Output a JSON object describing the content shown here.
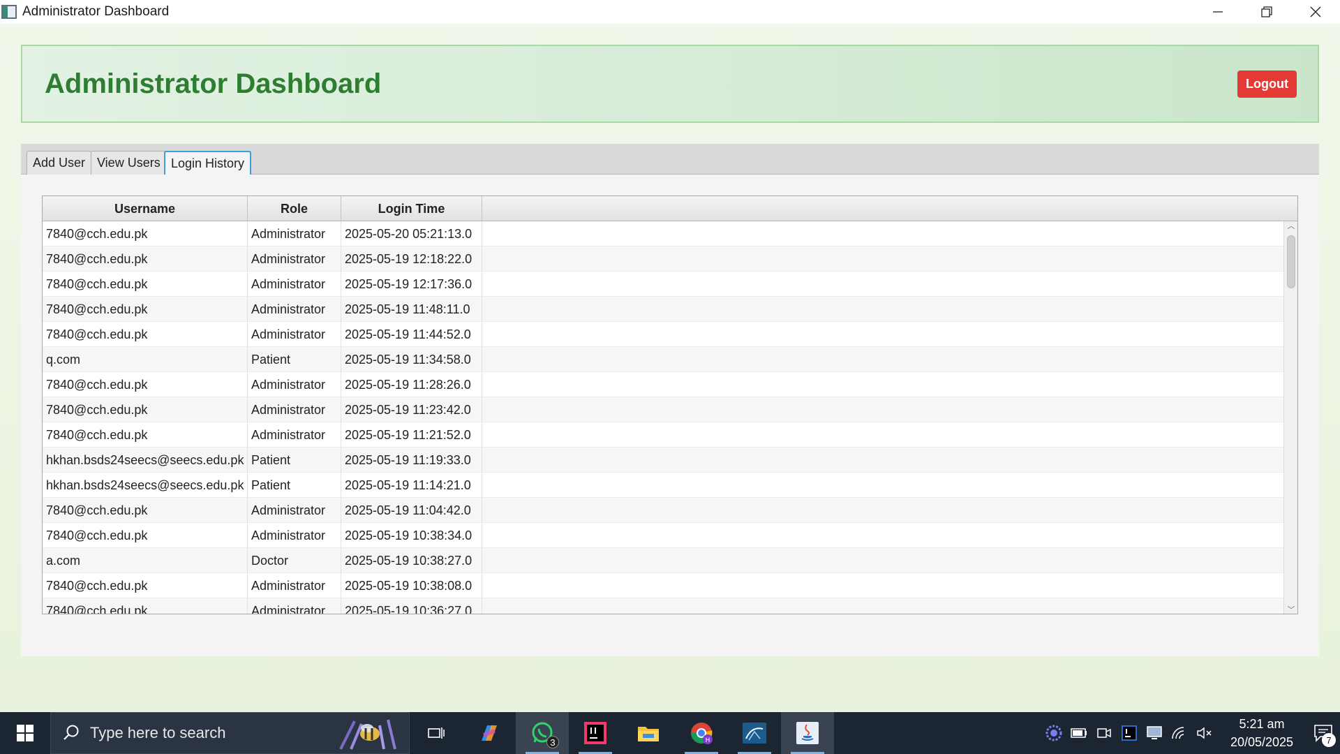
{
  "window": {
    "title": "Administrator Dashboard"
  },
  "header": {
    "title": "Administrator Dashboard",
    "logout_label": "Logout"
  },
  "tabs": [
    {
      "label": "Add User",
      "selected": false
    },
    {
      "label": "View Users",
      "selected": false
    },
    {
      "label": "Login History",
      "selected": true
    }
  ],
  "table": {
    "columns": [
      "Username",
      "Role",
      "Login Time"
    ],
    "rows": [
      {
        "username": "7840@cch.edu.pk",
        "role": "Administrator",
        "time": "2025-05-20 05:21:13.0"
      },
      {
        "username": "7840@cch.edu.pk",
        "role": "Administrator",
        "time": "2025-05-19 12:18:22.0"
      },
      {
        "username": "7840@cch.edu.pk",
        "role": "Administrator",
        "time": "2025-05-19 12:17:36.0"
      },
      {
        "username": "7840@cch.edu.pk",
        "role": "Administrator",
        "time": "2025-05-19 11:48:11.0"
      },
      {
        "username": "7840@cch.edu.pk",
        "role": "Administrator",
        "time": "2025-05-19 11:44:52.0"
      },
      {
        "username": "q.com",
        "role": "Patient",
        "time": "2025-05-19 11:34:58.0"
      },
      {
        "username": "7840@cch.edu.pk",
        "role": "Administrator",
        "time": "2025-05-19 11:28:26.0"
      },
      {
        "username": "7840@cch.edu.pk",
        "role": "Administrator",
        "time": "2025-05-19 11:23:42.0"
      },
      {
        "username": "7840@cch.edu.pk",
        "role": "Administrator",
        "time": "2025-05-19 11:21:52.0"
      },
      {
        "username": "hkhan.bsds24seecs@seecs.edu.pk",
        "role": "Patient",
        "time": "2025-05-19 11:19:33.0"
      },
      {
        "username": "hkhan.bsds24seecs@seecs.edu.pk",
        "role": "Patient",
        "time": "2025-05-19 11:14:21.0"
      },
      {
        "username": "7840@cch.edu.pk",
        "role": "Administrator",
        "time": "2025-05-19 11:04:42.0"
      },
      {
        "username": "7840@cch.edu.pk",
        "role": "Administrator",
        "time": "2025-05-19 10:38:34.0"
      },
      {
        "username": "a.com",
        "role": "Doctor",
        "time": "2025-05-19 10:38:27.0"
      },
      {
        "username": "7840@cch.edu.pk",
        "role": "Administrator",
        "time": "2025-05-19 10:38:08.0"
      },
      {
        "username": "7840@cch.edu.pk",
        "role": "Administrator",
        "time": "2025-05-19 10:36:27.0"
      }
    ]
  },
  "taskbar": {
    "search_placeholder": "Type here to search",
    "whatsapp_badge": "3",
    "clock_time": "5:21 am",
    "clock_date": "20/05/2025",
    "notification_count": "7"
  },
  "colors": {
    "header_title": "#2e7d32",
    "logout_bg": "#e53935",
    "selected_tab_border": "#3aa0dc"
  }
}
